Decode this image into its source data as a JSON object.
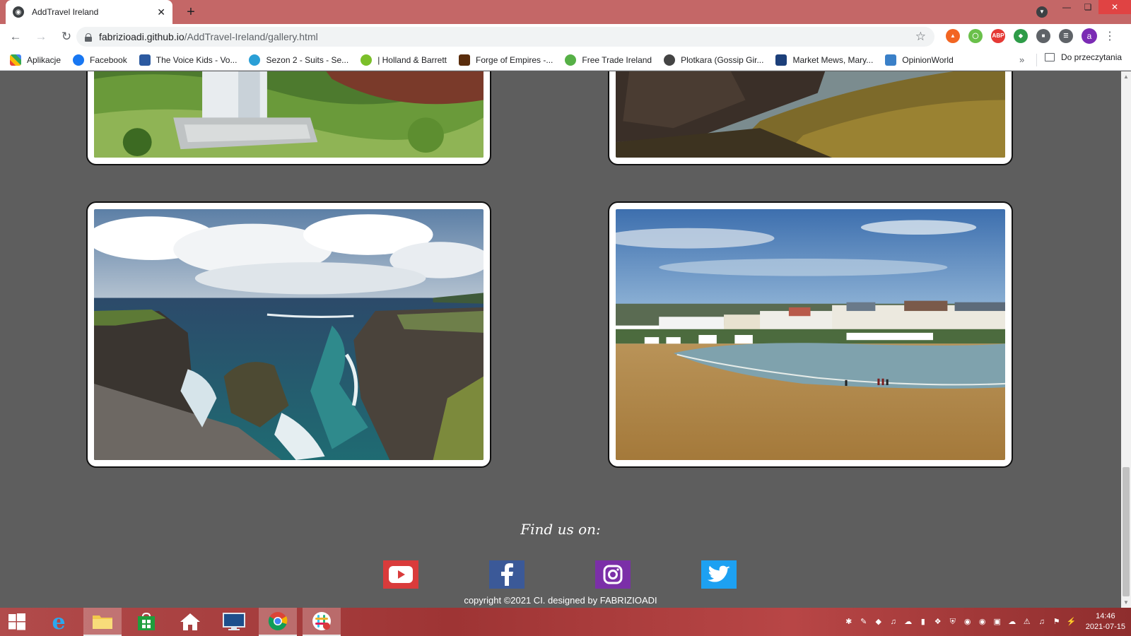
{
  "browser": {
    "tab_title": "AddTravel Ireland",
    "url_host": "fabrizioadi.github.io",
    "url_path": "/AddTravel-Ireland/gallery.html",
    "avatar_letter": "a"
  },
  "bookmarks": [
    {
      "label": "Aplikacje",
      "color": "#4285f4"
    },
    {
      "label": "Facebook",
      "color": "#1877f2"
    },
    {
      "label": "The Voice Kids - Vo...",
      "color": "#2c5aa0"
    },
    {
      "label": "Sezon 2 - Suits - Se...",
      "color": "#2a9fd6"
    },
    {
      "label": "| Holland & Barrett",
      "color": "#7bbf2a"
    },
    {
      "label": "Forge of Empires -...",
      "color": "#5a2d0c"
    },
    {
      "label": "Free Trade Ireland",
      "color": "#56b046"
    },
    {
      "label": "Plotkara (Gossip Gir...",
      "color": "#444444"
    },
    {
      "label": "Market Mews, Mary...",
      "color": "#1c3f7a"
    },
    {
      "label": "OpinionWorld",
      "color": "#3a80c8"
    }
  ],
  "reading_list": "Do przeczytania",
  "footer": {
    "find_us": "Find us on:",
    "copyright": "copyright ©2021 CI. designed by FABRIZIOADI",
    "socials": [
      "youtube",
      "facebook",
      "instagram",
      "twitter"
    ]
  },
  "taskbar": {
    "time": "14:46",
    "date": "2021-07-15"
  }
}
